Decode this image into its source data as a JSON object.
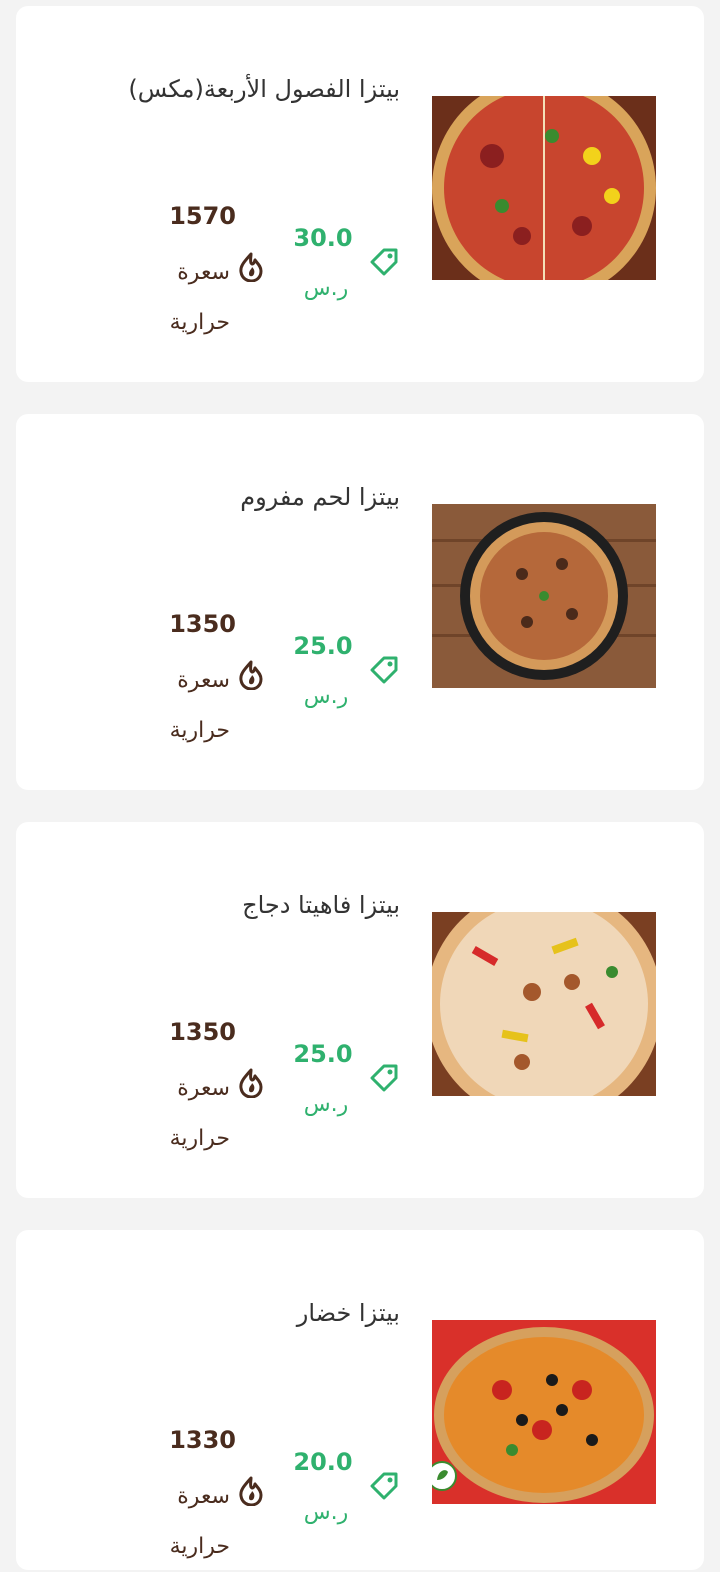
{
  "items": [
    {
      "title": "بيتزا الفصول الأربعة(مكس)",
      "price": "30.0",
      "currency": "ر.س",
      "calories": "1570",
      "calories_label": "سعرة حرارية",
      "image": "pizza-mix-image"
    },
    {
      "title": "بيتزا لحم مفروم",
      "price": "25.0",
      "currency": "ر.س",
      "calories": "1350",
      "calories_label": "سعرة حرارية",
      "image": "pizza-minced-meat-image"
    },
    {
      "title": "بيتزا فاهيتا دجاج",
      "price": "25.0",
      "currency": "ر.س",
      "calories": "1350",
      "calories_label": "سعرة حرارية",
      "image": "pizza-chicken-fajita-image"
    },
    {
      "title": "بيتزا خضار",
      "price": "20.0",
      "currency": "ر.س",
      "calories": "1330",
      "calories_label": "سعرة حرارية",
      "image": "pizza-vegetable-image"
    }
  ],
  "icons": {
    "price": "price-tag-icon",
    "calories": "flame-icon"
  },
  "colors": {
    "price": "#2fb16e",
    "calories": "#4a2c1e",
    "background": "#f3f3f3",
    "card": "#ffffff"
  }
}
